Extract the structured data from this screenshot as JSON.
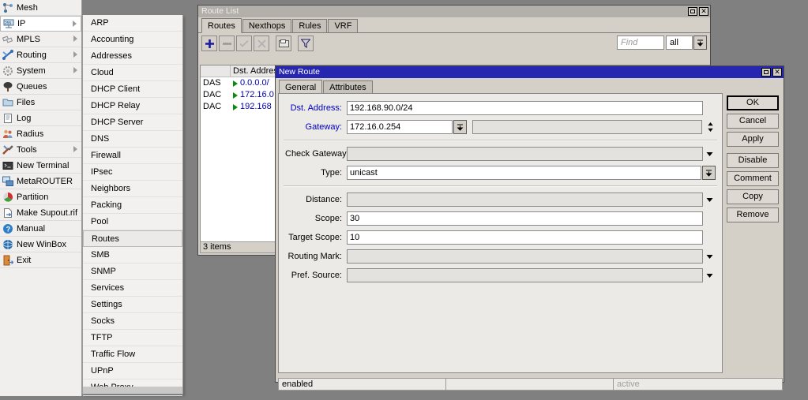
{
  "sidebar": {
    "items": [
      {
        "label": "Mesh",
        "icon": "mesh-icon",
        "arrow": false,
        "selected": false
      },
      {
        "label": "IP",
        "icon": "ip-icon",
        "arrow": true,
        "selected": true
      },
      {
        "label": "MPLS",
        "icon": "mpls-icon",
        "arrow": true,
        "selected": false
      },
      {
        "label": "Routing",
        "icon": "routing-icon",
        "arrow": true,
        "selected": false
      },
      {
        "label": "System",
        "icon": "system-icon",
        "arrow": true,
        "selected": false
      },
      {
        "label": "Queues",
        "icon": "queues-icon",
        "arrow": false,
        "selected": false
      },
      {
        "label": "Files",
        "icon": "files-icon",
        "arrow": false,
        "selected": false
      },
      {
        "label": "Log",
        "icon": "log-icon",
        "arrow": false,
        "selected": false
      },
      {
        "label": "Radius",
        "icon": "radius-icon",
        "arrow": false,
        "selected": false
      },
      {
        "label": "Tools",
        "icon": "tools-icon",
        "arrow": true,
        "selected": false
      },
      {
        "label": "New Terminal",
        "icon": "terminal-icon",
        "arrow": false,
        "selected": false
      },
      {
        "label": "MetaROUTER",
        "icon": "metarouter-icon",
        "arrow": false,
        "selected": false
      },
      {
        "label": "Partition",
        "icon": "partition-icon",
        "arrow": false,
        "selected": false
      },
      {
        "label": "Make Supout.rif",
        "icon": "supout-icon",
        "arrow": false,
        "selected": false
      },
      {
        "label": "Manual",
        "icon": "manual-icon",
        "arrow": false,
        "selected": false
      },
      {
        "label": "New WinBox",
        "icon": "new-winbox-icon",
        "arrow": false,
        "selected": false
      },
      {
        "label": "Exit",
        "icon": "exit-icon",
        "arrow": false,
        "selected": false
      }
    ]
  },
  "submenu": {
    "items": [
      {
        "label": "ARP",
        "selected": false
      },
      {
        "label": "Accounting",
        "selected": false
      },
      {
        "label": "Addresses",
        "selected": false
      },
      {
        "label": "Cloud",
        "selected": false
      },
      {
        "label": "DHCP Client",
        "selected": false
      },
      {
        "label": "DHCP Relay",
        "selected": false
      },
      {
        "label": "DHCP Server",
        "selected": false
      },
      {
        "label": "DNS",
        "selected": false
      },
      {
        "label": "Firewall",
        "selected": false
      },
      {
        "label": "IPsec",
        "selected": false
      },
      {
        "label": "Neighbors",
        "selected": false
      },
      {
        "label": "Packing",
        "selected": false
      },
      {
        "label": "Pool",
        "selected": false
      },
      {
        "label": "Routes",
        "selected": true
      },
      {
        "label": "SMB",
        "selected": false
      },
      {
        "label": "SNMP",
        "selected": false
      },
      {
        "label": "Services",
        "selected": false
      },
      {
        "label": "Settings",
        "selected": false
      },
      {
        "label": "Socks",
        "selected": false
      },
      {
        "label": "TFTP",
        "selected": false
      },
      {
        "label": "Traffic Flow",
        "selected": false
      },
      {
        "label": "UPnP",
        "selected": false
      },
      {
        "label": "Web Proxy",
        "selected": false
      }
    ]
  },
  "route_list": {
    "title": "Route List",
    "tabs": [
      {
        "label": "Routes",
        "active": true
      },
      {
        "label": "Nexthops",
        "active": false
      },
      {
        "label": "Rules",
        "active": false
      },
      {
        "label": "VRF",
        "active": false
      }
    ],
    "toolbar": {
      "add": "add-icon",
      "remove": "remove-icon",
      "enable": "enable-check-icon",
      "disable": "disable-cross-icon",
      "comment": "comment-icon",
      "filter": "filter-funnel-icon",
      "find_placeholder": "Find",
      "scope_value": "all"
    },
    "columns": [
      "",
      "Dst. Address"
    ],
    "rows": [
      {
        "flags": "DAS",
        "dst": "0.0.0.0/"
      },
      {
        "flags": "DAC",
        "dst": "172.16.0"
      },
      {
        "flags": "DAC",
        "dst": "192.168"
      }
    ],
    "status": "3 items"
  },
  "new_route": {
    "title": "New Route",
    "tabs": [
      {
        "label": "General",
        "active": true
      },
      {
        "label": "Attributes",
        "active": false
      }
    ],
    "fields": [
      {
        "label": "Dst. Address:",
        "value": "192.168.90.0/24",
        "kind": "text",
        "blue": true
      },
      {
        "label": "Gateway:",
        "value": "172.16.0.254",
        "kind": "gateway",
        "blue": true
      },
      {
        "label": "Check Gateway:",
        "value": "",
        "kind": "dropdown",
        "blue": false
      },
      {
        "label": "Type:",
        "value": "unicast",
        "kind": "combo",
        "blue": false
      },
      {
        "label": "Distance:",
        "value": "",
        "kind": "dropdown",
        "blue": false
      },
      {
        "label": "Scope:",
        "value": "30",
        "kind": "text",
        "blue": false
      },
      {
        "label": "Target Scope:",
        "value": "10",
        "kind": "text",
        "blue": false
      },
      {
        "label": "Routing Mark:",
        "value": "",
        "kind": "dropdown",
        "blue": false
      },
      {
        "label": "Pref. Source:",
        "value": "",
        "kind": "dropdown",
        "blue": false
      }
    ],
    "buttons": [
      {
        "label": "OK",
        "default": true,
        "spaced": false
      },
      {
        "label": "Cancel",
        "default": false,
        "spaced": false
      },
      {
        "label": "Apply",
        "default": false,
        "spaced": false
      },
      {
        "label": "Disable",
        "default": false,
        "spaced": true
      },
      {
        "label": "Comment",
        "default": false,
        "spaced": false
      },
      {
        "label": "Copy",
        "default": false,
        "spaced": false
      },
      {
        "label": "Remove",
        "default": false,
        "spaced": false
      }
    ],
    "status": {
      "left": "enabled",
      "middle": "",
      "right": "active"
    }
  },
  "colors": {
    "active_titlebar": "#2626b0",
    "inactive_titlebar": "#b3b0ab",
    "window_face": "#d4d0c8",
    "field_label_blue": "#0000c0",
    "route_value_blue": "#0000a8",
    "route_arrow_green": "#0d8a0d",
    "desktop": "#808080"
  }
}
